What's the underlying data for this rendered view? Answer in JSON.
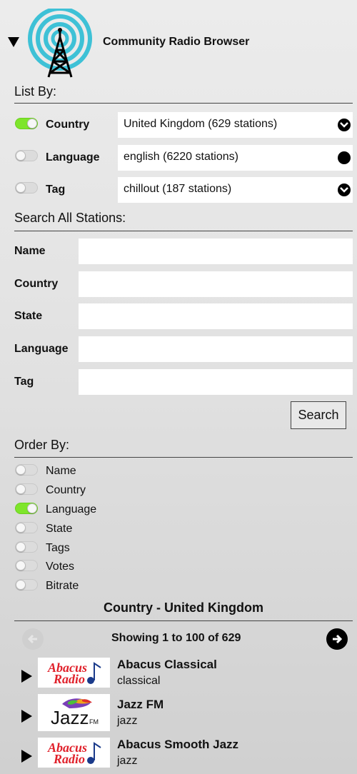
{
  "header": {
    "title": "Community Radio Browser",
    "logo_icon": "radio-tower-icon"
  },
  "list_by": {
    "title": "List By:",
    "rows": [
      {
        "label": "Country",
        "enabled": true,
        "value": "United Kingdom (629 stations)",
        "icon": "chevron-circle-icon"
      },
      {
        "label": "Language",
        "enabled": false,
        "value": "english (6220 stations)",
        "icon": "dot-icon"
      },
      {
        "label": "Tag",
        "enabled": false,
        "value": "chillout (187 stations)",
        "icon": "chevron-circle-icon"
      }
    ]
  },
  "search": {
    "title": "Search All Stations:",
    "fields": [
      {
        "label": "Name",
        "value": ""
      },
      {
        "label": "Country",
        "value": ""
      },
      {
        "label": "State",
        "value": ""
      },
      {
        "label": "Language",
        "value": ""
      },
      {
        "label": "Tag",
        "value": ""
      }
    ],
    "button_label": "Search"
  },
  "order_by": {
    "title": "Order By:",
    "options": [
      {
        "label": "Name",
        "enabled": false
      },
      {
        "label": "Country",
        "enabled": false
      },
      {
        "label": "Language",
        "enabled": true
      },
      {
        "label": "State",
        "enabled": false
      },
      {
        "label": "Tags",
        "enabled": false
      },
      {
        "label": "Votes",
        "enabled": false
      },
      {
        "label": "Bitrate",
        "enabled": false
      }
    ]
  },
  "results": {
    "title": "Country - United Kingdom",
    "showing": "Showing 1 to 100 of 629",
    "stations": [
      {
        "name": "Abacus Classical",
        "tag": "classical",
        "logo_text": "Abacus Radio"
      },
      {
        "name": "Jazz FM",
        "tag": "jazz",
        "logo_text": "Jazz FM"
      },
      {
        "name": "Abacus Smooth Jazz",
        "tag": "jazz",
        "logo_text": "Abacus Radio"
      }
    ]
  },
  "colors": {
    "toggle_on": "#7ee52b",
    "abacus_red": "#e0202a",
    "logo_teal": "#3ec1d6"
  }
}
